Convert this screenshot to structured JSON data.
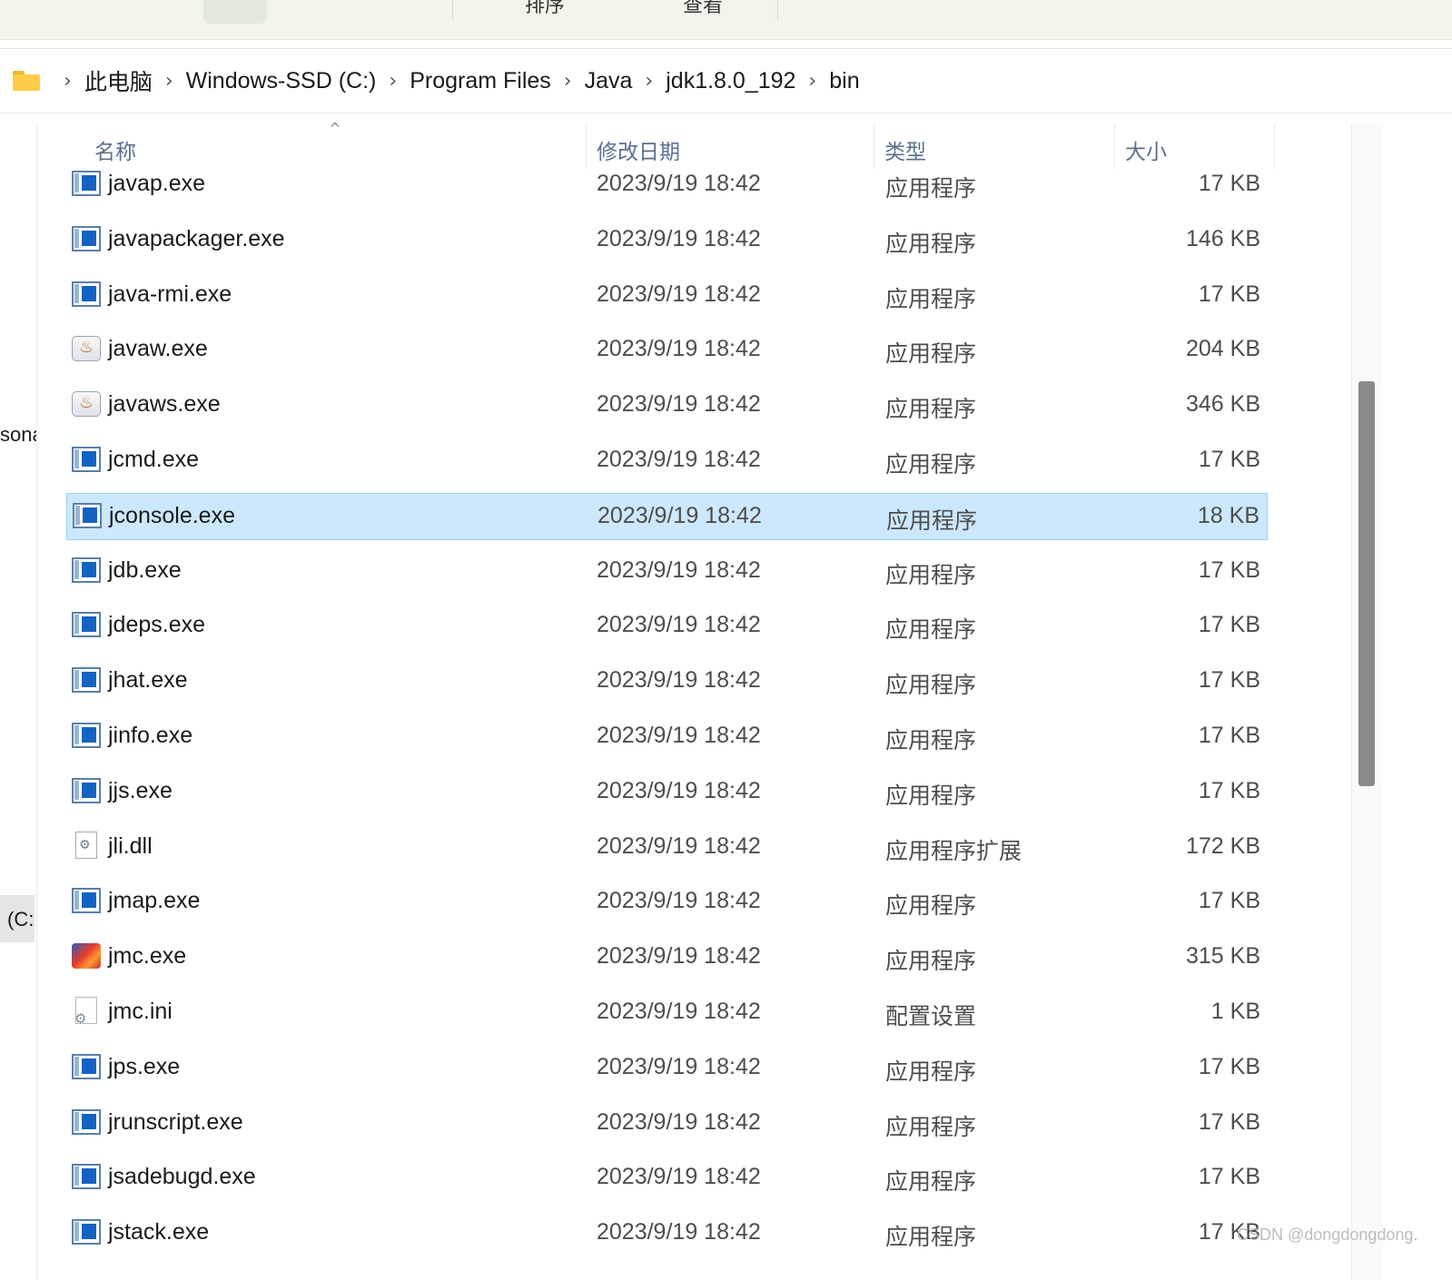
{
  "toolbar": {
    "label_a": "排序",
    "label_b": "查看"
  },
  "breadcrumb": [
    "此电脑",
    "Windows-SSD (C:)",
    "Program Files",
    "Java",
    "jdk1.8.0_192",
    "bin"
  ],
  "nav": {
    "fragment_1": "sona",
    "fragment_2": "(C:"
  },
  "columns": {
    "name": "名称",
    "date": "修改日期",
    "type": "类型",
    "size": "大小"
  },
  "rows": [
    {
      "name": "javap.exe",
      "date": "2023/9/19 18:42",
      "type": "应用程序",
      "size": "17 KB",
      "icon": "exe-icon"
    },
    {
      "name": "javapackager.exe",
      "date": "2023/9/19 18:42",
      "type": "应用程序",
      "size": "146 KB",
      "icon": "exe-icon"
    },
    {
      "name": "java-rmi.exe",
      "date": "2023/9/19 18:42",
      "type": "应用程序",
      "size": "17 KB",
      "icon": "exe-icon"
    },
    {
      "name": "javaw.exe",
      "date": "2023/9/19 18:42",
      "type": "应用程序",
      "size": "204 KB",
      "icon": "java-icon"
    },
    {
      "name": "javaws.exe",
      "date": "2023/9/19 18:42",
      "type": "应用程序",
      "size": "346 KB",
      "icon": "java-icon"
    },
    {
      "name": "jcmd.exe",
      "date": "2023/9/19 18:42",
      "type": "应用程序",
      "size": "17 KB",
      "icon": "exe-icon"
    },
    {
      "name": "jconsole.exe",
      "date": "2023/9/19 18:42",
      "type": "应用程序",
      "size": "18 KB",
      "icon": "exe-icon",
      "selected": true
    },
    {
      "name": "jdb.exe",
      "date": "2023/9/19 18:42",
      "type": "应用程序",
      "size": "17 KB",
      "icon": "exe-icon"
    },
    {
      "name": "jdeps.exe",
      "date": "2023/9/19 18:42",
      "type": "应用程序",
      "size": "17 KB",
      "icon": "exe-icon"
    },
    {
      "name": "jhat.exe",
      "date": "2023/9/19 18:42",
      "type": "应用程序",
      "size": "17 KB",
      "icon": "exe-icon"
    },
    {
      "name": "jinfo.exe",
      "date": "2023/9/19 18:42",
      "type": "应用程序",
      "size": "17 KB",
      "icon": "exe-icon"
    },
    {
      "name": "jjs.exe",
      "date": "2023/9/19 18:42",
      "type": "应用程序",
      "size": "17 KB",
      "icon": "exe-icon"
    },
    {
      "name": "jli.dll",
      "date": "2023/9/19 18:42",
      "type": "应用程序扩展",
      "size": "172 KB",
      "icon": "dll-icon"
    },
    {
      "name": "jmap.exe",
      "date": "2023/9/19 18:42",
      "type": "应用程序",
      "size": "17 KB",
      "icon": "exe-icon"
    },
    {
      "name": "jmc.exe",
      "date": "2023/9/19 18:42",
      "type": "应用程序",
      "size": "315 KB",
      "icon": "jmc-icon"
    },
    {
      "name": "jmc.ini",
      "date": "2023/9/19 18:42",
      "type": "配置设置",
      "size": "1 KB",
      "icon": "ini-icon"
    },
    {
      "name": "jps.exe",
      "date": "2023/9/19 18:42",
      "type": "应用程序",
      "size": "17 KB",
      "icon": "exe-icon"
    },
    {
      "name": "jrunscript.exe",
      "date": "2023/9/19 18:42",
      "type": "应用程序",
      "size": "17 KB",
      "icon": "exe-icon"
    },
    {
      "name": "jsadebugd.exe",
      "date": "2023/9/19 18:42",
      "type": "应用程序",
      "size": "17 KB",
      "icon": "exe-icon"
    },
    {
      "name": "jstack.exe",
      "date": "2023/9/19 18:42",
      "type": "应用程序",
      "size": "17 KB",
      "icon": "exe-icon"
    }
  ],
  "watermark": "CSDN @dongdongdong."
}
